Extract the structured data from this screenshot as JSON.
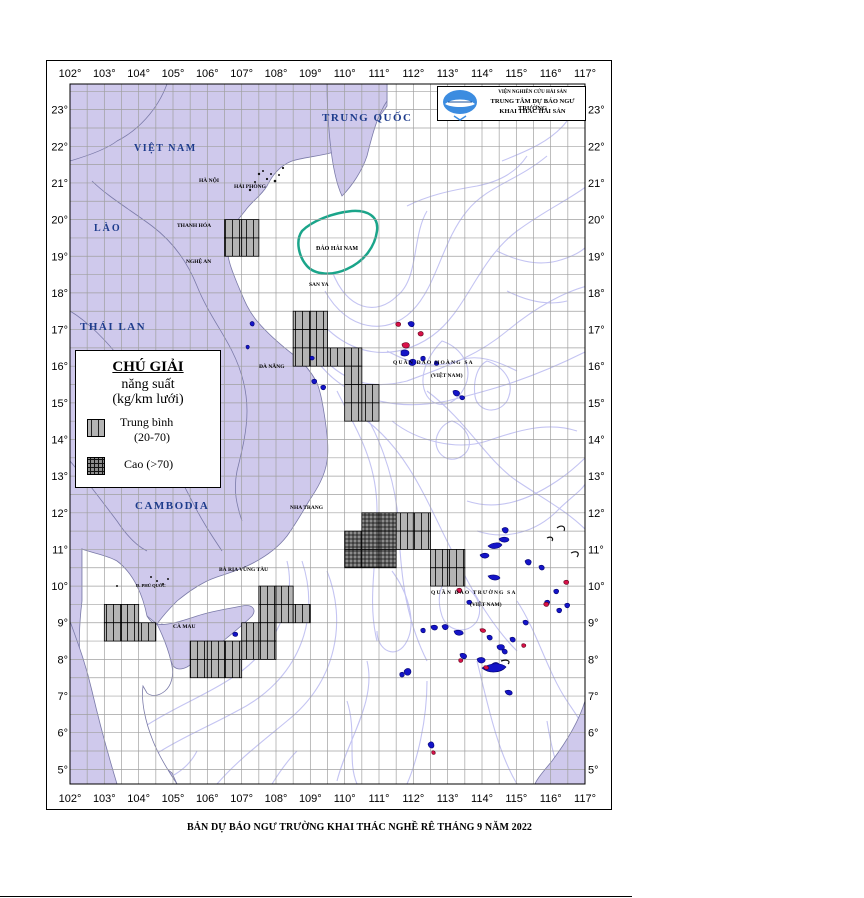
{
  "map": {
    "lon_labels": [
      "102°",
      "103°",
      "104°",
      "105°",
      "106°",
      "107°",
      "108°",
      "109°",
      "110°",
      "111°",
      "112°",
      "113°",
      "114°",
      "115°",
      "116°",
      "117°"
    ],
    "lat_labels": [
      "23°",
      "22°",
      "21°",
      "20°",
      "19°",
      "18°",
      "17°",
      "16°",
      "15°",
      "14°",
      "13°",
      "12°",
      "11°",
      "10°",
      "9°",
      "8°",
      "7°",
      "6°",
      "5°"
    ],
    "lon_range": [
      102,
      117
    ],
    "lat_range": [
      4.6,
      23.7
    ],
    "colors": {
      "land": "#cfc9ec",
      "contour": "#c4c4f2",
      "grid": "#a0a0a0",
      "high_catch_fill": "#8c8c8c",
      "medium_catch_fill": "#b4b4b4"
    },
    "country_labels": {
      "vietnam": "VIỆT NAM",
      "laos": "LÀO",
      "thailand": "THÁI LAN",
      "cambodia": "CAMBODIA",
      "china": "TRUNG QUỐC"
    },
    "place_labels": {
      "hanoi": "HÀ NỘI",
      "haiphong": "HẢI PHÒNG",
      "thanhhoa": "THANH HÓA",
      "nghean": "NGHỆ AN",
      "danang": "ĐÀ NẴNG",
      "nhatrang": "NHA TRANG",
      "bariavungtau": "BÀ RỊA VŨNG TÀU",
      "camau": "CÀ MAU",
      "phuquoc": "Đ. PHÚ QUỐC",
      "sanya": "SAN YA",
      "hainan": "ĐẢO HẢI NAM",
      "hoangsa": "QUẦN ĐẢO HOÀNG SA",
      "hoangsa_vn": "(VIỆT NAM)",
      "truongsa": "QUẦN ĐẢO TRƯỜNG SA",
      "truongsa_vn": "(VIỆT NAM)"
    },
    "forecast_cells": {
      "medium": [
        [
          106.5,
          19.5
        ],
        [
          107,
          19.5
        ],
        [
          106.5,
          19
        ],
        [
          107,
          19
        ],
        [
          108.5,
          17
        ],
        [
          109,
          17
        ],
        [
          108.5,
          16.5
        ],
        [
          109,
          16.5
        ],
        [
          108.5,
          16
        ],
        [
          109,
          16
        ],
        [
          109.5,
          16
        ],
        [
          110,
          16
        ],
        [
          110,
          15.5
        ],
        [
          110,
          15
        ],
        [
          110.5,
          15
        ],
        [
          110,
          14.5
        ],
        [
          110.5,
          14.5
        ],
        [
          111.5,
          11.5
        ],
        [
          112,
          11.5
        ],
        [
          111.5,
          11
        ],
        [
          112,
          11
        ],
        [
          112.5,
          10.5
        ],
        [
          113,
          10.5
        ],
        [
          112.5,
          10
        ],
        [
          113,
          10
        ],
        [
          103,
          9
        ],
        [
          103.5,
          9
        ],
        [
          103,
          8.5
        ],
        [
          103.5,
          8.5
        ],
        [
          104,
          8.5
        ],
        [
          107.5,
          9.5
        ],
        [
          108,
          9.5
        ],
        [
          107.5,
          9
        ],
        [
          108,
          9
        ],
        [
          108.5,
          9
        ],
        [
          107,
          8.5
        ],
        [
          107.5,
          8.5
        ],
        [
          107,
          8
        ],
        [
          107.5,
          8
        ],
        [
          105.5,
          8
        ],
        [
          106,
          8
        ],
        [
          106.5,
          8
        ],
        [
          105.5,
          7.5
        ],
        [
          106,
          7.5
        ],
        [
          106.5,
          7.5
        ]
      ],
      "high": [
        [
          110.5,
          11.5
        ],
        [
          111,
          11.5
        ],
        [
          110,
          11
        ],
        [
          110.5,
          11
        ],
        [
          111,
          11
        ],
        [
          110,
          10.5
        ],
        [
          110.5,
          10.5
        ],
        [
          111,
          10.5
        ]
      ]
    }
  },
  "legend": {
    "title": "CHÚ GIẢI",
    "subtitle_line1": "năng suất",
    "subtitle_line2": "(kg/km lưới)",
    "medium_label": "Trung bình",
    "medium_range": "(20-70)",
    "high_label": "Cao (>70)"
  },
  "logo": {
    "line1": "VIỆN NGHIÊN CỨU HẢI SẢN",
    "line2": "TRUNG TÂM DỰ BÁO NGƯ TRƯỜNG",
    "line3": "KHAI THÁC HẢI SẢN"
  },
  "caption": "BẢN DỰ BÁO NGƯ TRƯỜNG KHAI THÁC NGHỀ RÊ THÁNG 9 NĂM 2022"
}
